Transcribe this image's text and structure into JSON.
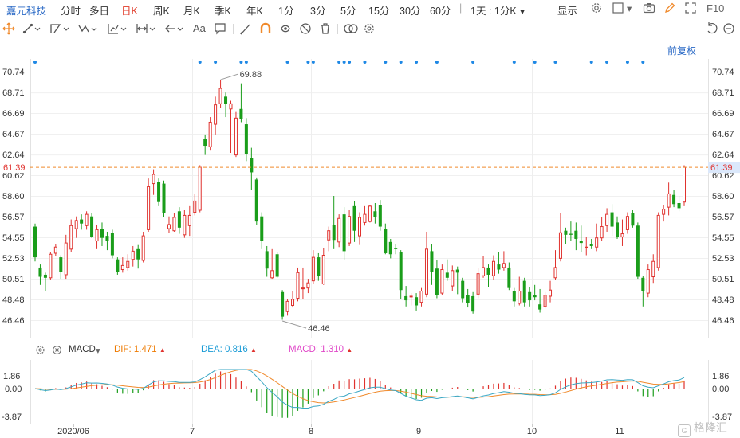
{
  "header": {
    "stock_name": "嘉元科技",
    "periods": [
      "分时",
      "多日",
      "日K",
      "周K",
      "月K",
      "季K",
      "年K",
      "1分",
      "3分",
      "5分",
      "15分",
      "30分",
      "60分"
    ],
    "active_period": "日K",
    "time_select": "1天 : 1分K",
    "display_label": "显示",
    "f10_label": "F10"
  },
  "adjust_label": "前复权",
  "colors": {
    "up": "#e0322e",
    "down": "#1a9d1a",
    "dif": "#3aa7c4",
    "dea": "#f08a2c",
    "macd_label": "#e048c8",
    "dif_label": "#ee7a00",
    "dea_label": "#1a9bd6",
    "accent": "#2b6ac6"
  },
  "main_axis": {
    "ticks": [
      "70.74",
      "68.71",
      "66.69",
      "64.67",
      "62.64",
      "60.62",
      "58.60",
      "56.57",
      "54.55",
      "52.53",
      "50.51",
      "48.48",
      "46.46"
    ],
    "current_price_label": "61.39",
    "max_label": "69.88",
    "min_label": "46.46"
  },
  "macd": {
    "label": "MACD",
    "dif_label": "DIF: 1.471",
    "dea_label": "DEA: 0.816",
    "macd_label": "MACD: 1.310",
    "axis_ticks": [
      "1.86",
      "0.00",
      "-3.87"
    ]
  },
  "x_axis": {
    "labels": [
      "2020/06",
      "7",
      "8",
      "9",
      "10",
      "11"
    ]
  },
  "watermark": "格隆汇",
  "chart_data": {
    "type": "candlestick",
    "ylim": [
      45.5,
      71.3
    ],
    "y_ticks": [
      70.74,
      68.71,
      66.69,
      64.67,
      62.64,
      60.62,
      58.6,
      56.57,
      54.55,
      52.53,
      50.51,
      48.48,
      46.46
    ],
    "last_price": 61.39,
    "marked_high": 69.88,
    "marked_low": 46.46,
    "macd": {
      "dif": 1.471,
      "dea": 0.816,
      "macd": 1.31,
      "ylim": [
        -3.87,
        1.86
      ]
    },
    "candles": [
      [
        55.6,
        52.6,
        55.9,
        52.2
      ],
      [
        51.6,
        50.7,
        51.9,
        49.9
      ],
      [
        50.9,
        50.6,
        51.1,
        49.3
      ],
      [
        50.6,
        52.9,
        53.1,
        50.4
      ],
      [
        53.0,
        53.6,
        53.9,
        52.7
      ],
      [
        52.6,
        51.2,
        52.8,
        50.5
      ],
      [
        50.9,
        54.0,
        54.8,
        50.5
      ],
      [
        53.4,
        55.7,
        56.3,
        53.1
      ],
      [
        55.4,
        56.2,
        56.6,
        54.5
      ],
      [
        56.3,
        55.9,
        56.8,
        55.3
      ],
      [
        55.7,
        56.8,
        57.1,
        55.3
      ],
      [
        56.6,
        54.6,
        56.9,
        54.5
      ],
      [
        54.2,
        55.3,
        55.8,
        53.4
      ],
      [
        55.4,
        54.5,
        56.0,
        53.7
      ],
      [
        54.7,
        54.2,
        55.1,
        53.3
      ],
      [
        55.0,
        52.8,
        55.3,
        52.5
      ],
      [
        52.4,
        51.2,
        52.6,
        50.9
      ],
      [
        51.4,
        51.8,
        52.6,
        51.1
      ],
      [
        51.6,
        52.2,
        52.9,
        51.3
      ],
      [
        52.4,
        53.2,
        53.7,
        51.7
      ],
      [
        53.4,
        52.4,
        53.8,
        51.5
      ],
      [
        52.3,
        54.7,
        55.1,
        52.1
      ],
      [
        55.3,
        59.5,
        60.3,
        55.1
      ],
      [
        59.8,
        60.7,
        61.2,
        58.7
      ],
      [
        60.0,
        58.0,
        60.3,
        57.6
      ],
      [
        59.8,
        56.9,
        60.1,
        56.5
      ],
      [
        55.4,
        55.8,
        56.6,
        55.0
      ],
      [
        55.2,
        56.5,
        56.9,
        55.1
      ],
      [
        57.1,
        55.5,
        57.5,
        54.9
      ],
      [
        54.8,
        56.7,
        57.2,
        54.5
      ],
      [
        55.7,
        56.7,
        57.6,
        54.7
      ],
      [
        57.0,
        58.1,
        58.8,
        56.7
      ],
      [
        57.2,
        61.4,
        61.6,
        57.0
      ],
      [
        64.2,
        63.5,
        64.6,
        62.6
      ],
      [
        63.4,
        65.8,
        66.3,
        63.1
      ],
      [
        65.6,
        67.5,
        68.3,
        64.6
      ],
      [
        67.6,
        69.1,
        69.9,
        67.2
      ],
      [
        68.3,
        67.6,
        68.7,
        66.3
      ],
      [
        67.1,
        67.6,
        67.9,
        62.8
      ],
      [
        62.6,
        66.2,
        66.8,
        62.4
      ],
      [
        67.1,
        66.1,
        69.6,
        65.8
      ],
      [
        65.6,
        62.7,
        66.2,
        62.0
      ],
      [
        62.3,
        60.9,
        63.3,
        59.2
      ],
      [
        60.2,
        56.1,
        60.4,
        55.8
      ],
      [
        56.6,
        54.2,
        57.0,
        53.4
      ],
      [
        53.2,
        51.5,
        53.7,
        50.7
      ],
      [
        50.6,
        51.3,
        53.4,
        50.5
      ],
      [
        52.9,
        50.7,
        53.1,
        50.6
      ],
      [
        49.2,
        46.8,
        49.4,
        46.5
      ],
      [
        47.3,
        48.3,
        48.5,
        46.9
      ],
      [
        47.9,
        48.5,
        49.3,
        47.7
      ],
      [
        48.6,
        51.1,
        51.6,
        48.3
      ],
      [
        49.6,
        49.6,
        51.6,
        48.5
      ],
      [
        49.6,
        50.1,
        50.5,
        49.1
      ],
      [
        50.3,
        52.6,
        53.3,
        50.0
      ],
      [
        52.6,
        50.8,
        53.0,
        50.3
      ],
      [
        50.0,
        52.8,
        53.5,
        49.9
      ],
      [
        54.3,
        55.2,
        55.6,
        53.2
      ],
      [
        55.8,
        54.3,
        58.6,
        53.4
      ],
      [
        54.1,
        56.4,
        56.8,
        53.6
      ],
      [
        56.8,
        53.2,
        57.5,
        52.3
      ],
      [
        54.0,
        56.6,
        57.2,
        53.7
      ],
      [
        57.6,
        55.2,
        58.1,
        54.1
      ],
      [
        54.7,
        56.5,
        57.0,
        53.8
      ],
      [
        56.0,
        56.8,
        57.6,
        55.7
      ],
      [
        56.1,
        57.6,
        57.7,
        56.0
      ],
      [
        57.1,
        56.5,
        57.9,
        55.9
      ],
      [
        57.7,
        55.6,
        58.2,
        55.2
      ],
      [
        55.4,
        53.0,
        55.9,
        52.9
      ],
      [
        54.1,
        52.9,
        54.4,
        52.5
      ],
      [
        53.5,
        53.4,
        53.9,
        52.9
      ],
      [
        53.1,
        49.4,
        53.3,
        48.5
      ],
      [
        48.8,
        48.4,
        49.8,
        47.8
      ],
      [
        48.8,
        48.8,
        49.1,
        47.9
      ],
      [
        48.7,
        47.9,
        49.1,
        47.4
      ],
      [
        48.2,
        49.3,
        49.6,
        47.8
      ],
      [
        49.0,
        53.4,
        55.1,
        48.7
      ],
      [
        53.2,
        51.2,
        53.9,
        49.9
      ],
      [
        51.5,
        48.9,
        52.3,
        48.6
      ],
      [
        49.1,
        51.4,
        51.9,
        48.9
      ],
      [
        51.1,
        50.6,
        52.4,
        50.3
      ],
      [
        49.8,
        51.3,
        51.8,
        49.3
      ],
      [
        51.4,
        51.1,
        51.7,
        49.0
      ],
      [
        50.3,
        48.6,
        50.6,
        48.2
      ],
      [
        48.9,
        48.1,
        49.5,
        47.7
      ],
      [
        48.8,
        47.3,
        49.2,
        47.1
      ],
      [
        49.0,
        51.0,
        51.6,
        48.6
      ],
      [
        50.8,
        51.6,
        52.7,
        50.6
      ],
      [
        51.6,
        50.9,
        51.9,
        49.7
      ],
      [
        50.8,
        52.2,
        52.8,
        50.4
      ],
      [
        51.9,
        51.4,
        53.1,
        51.0
      ],
      [
        51.6,
        52.0,
        53.2,
        51.3
      ],
      [
        51.6,
        49.6,
        52.1,
        49.4
      ],
      [
        49.3,
        48.3,
        49.6,
        47.8
      ],
      [
        48.1,
        49.3,
        50.7,
        47.9
      ],
      [
        50.3,
        48.2,
        50.6,
        47.8
      ],
      [
        49.2,
        48.4,
        49.7,
        47.8
      ],
      [
        48.9,
        48.7,
        49.9,
        48.4
      ],
      [
        48.0,
        47.5,
        49.5,
        47.2
      ],
      [
        47.8,
        48.9,
        49.2,
        47.6
      ],
      [
        48.8,
        49.4,
        50.3,
        48.2
      ],
      [
        50.6,
        51.6,
        53.3,
        50.4
      ],
      [
        52.5,
        55.0,
        56.9,
        52.2
      ],
      [
        55.2,
        54.8,
        55.5,
        53.9
      ],
      [
        54.9,
        54.8,
        56.1,
        54.2
      ],
      [
        55.2,
        54.4,
        56.0,
        53.3
      ],
      [
        54.2,
        54.0,
        55.7,
        53.1
      ],
      [
        53.6,
        53.6,
        54.6,
        52.8
      ],
      [
        53.9,
        53.7,
        54.4,
        53.4
      ],
      [
        53.6,
        54.5,
        55.9,
        53.2
      ],
      [
        54.5,
        55.6,
        56.5,
        54.2
      ],
      [
        55.7,
        56.8,
        57.4,
        55.1
      ],
      [
        57.0,
        55.6,
        57.8,
        54.7
      ],
      [
        56.0,
        54.6,
        56.6,
        54.4
      ],
      [
        54.6,
        54.9,
        56.3,
        53.7
      ],
      [
        55.3,
        56.6,
        57.0,
        54.9
      ],
      [
        56.9,
        55.7,
        57.2,
        55.5
      ],
      [
        55.7,
        50.7,
        56.0,
        50.5
      ],
      [
        50.6,
        49.3,
        50.8,
        47.8
      ],
      [
        49.1,
        51.4,
        51.9,
        48.7
      ],
      [
        50.7,
        52.2,
        52.9,
        50.1
      ],
      [
        51.6,
        56.7,
        57.0,
        51.3
      ],
      [
        56.8,
        57.3,
        57.7,
        56.1
      ],
      [
        57.5,
        58.8,
        59.9,
        56.7
      ],
      [
        58.7,
        57.8,
        59.2,
        57.5
      ],
      [
        57.9,
        57.4,
        58.6,
        57.1
      ],
      [
        58.0,
        61.4,
        61.6,
        57.6
      ]
    ]
  }
}
